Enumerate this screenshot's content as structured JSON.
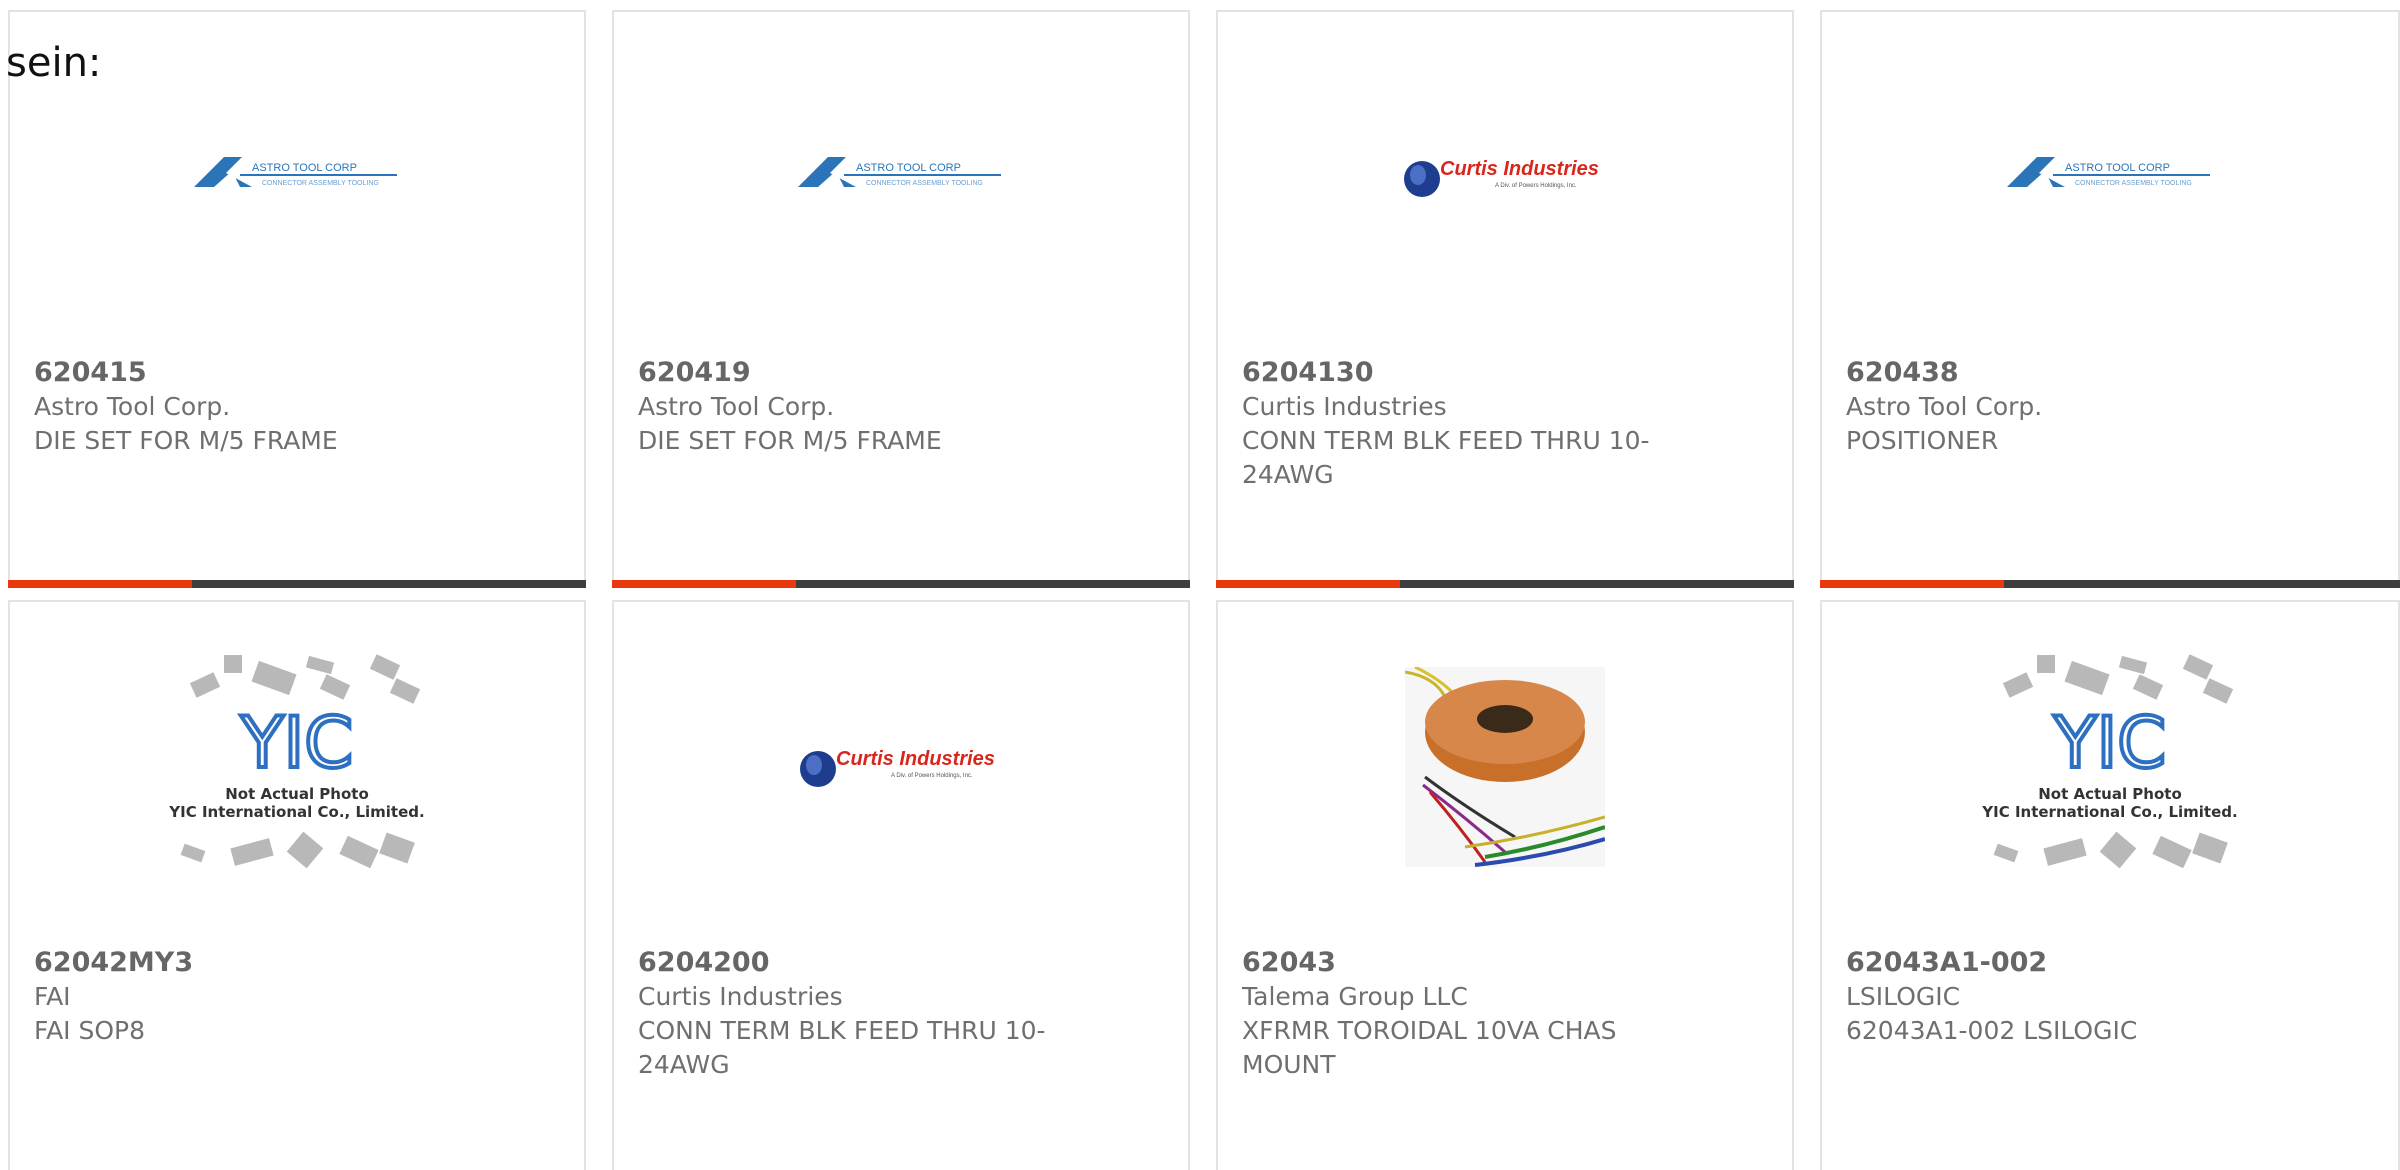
{
  "caption": "sein:",
  "colors": {
    "accent": "#e8380d",
    "bar": "#3e3e3e",
    "text": "#6f6f6f"
  },
  "products": [
    {
      "part": "620415",
      "manufacturer": "Astro Tool Corp.",
      "description": "DIE SET FOR M/5 FRAME",
      "image": "astro-tool-corp-logo"
    },
    {
      "part": "620419",
      "manufacturer": "Astro Tool Corp.",
      "description": "DIE SET FOR M/5 FRAME",
      "image": "astro-tool-corp-logo"
    },
    {
      "part": "6204130",
      "manufacturer": "Curtis Industries",
      "description": "CONN TERM BLK FEED THRU 10-24AWG",
      "image": "curtis-industries-logo"
    },
    {
      "part": "620438",
      "manufacturer": "Astro Tool Corp.",
      "description": "POSITIONER",
      "image": "astro-tool-corp-logo"
    },
    {
      "part": "62042MY3",
      "manufacturer": "FAI",
      "description": "FAI SOP8",
      "image": "yic-placeholder"
    },
    {
      "part": "6204200",
      "manufacturer": "Curtis Industries",
      "description": "CONN TERM BLK FEED THRU 10-24AWG",
      "image": "curtis-industries-logo"
    },
    {
      "part": "62043",
      "manufacturer": "Talema Group LLC",
      "description": "XFRMR TOROIDAL 10VA CHAS MOUNT",
      "image": "toroidal-transformer-photo"
    },
    {
      "part": "62043A1-002",
      "manufacturer": "LSILOGIC",
      "description": "62043A1-002 LSILOGIC",
      "image": "yic-placeholder"
    }
  ],
  "logos": {
    "astro": {
      "name": "ASTRO TOOL CORP",
      "tagline": "CONNECTOR ASSEMBLY TOOLING"
    },
    "curtis": {
      "name": "Curtis Industries",
      "tagline": "A Div. of Powers Holdings, Inc."
    },
    "yic": {
      "mark": "YIC",
      "line1": "Not Actual Photo",
      "line2": "YIC International Co., Limited."
    }
  }
}
